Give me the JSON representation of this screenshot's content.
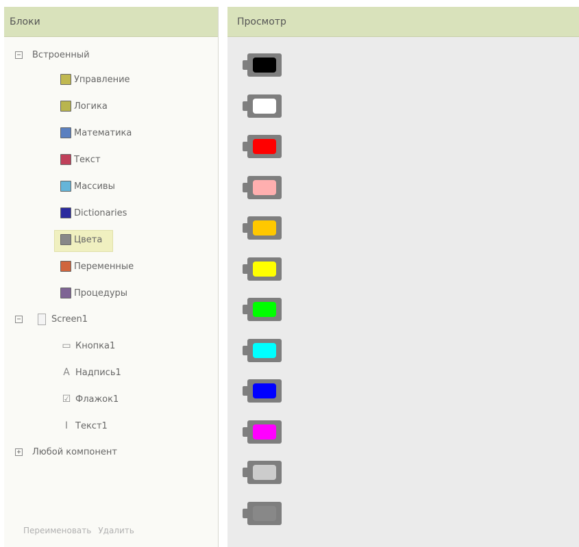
{
  "blocks_panel": {
    "header": "Блоки",
    "builtin": {
      "label": "Встроенный",
      "items": [
        {
          "label": "Управление",
          "color": "#c0b850",
          "icon": "control-swatch-icon"
        },
        {
          "label": "Логика",
          "color": "#b9b54e",
          "icon": "logic-swatch-icon"
        },
        {
          "label": "Математика",
          "color": "#5b80c0",
          "icon": "math-swatch-icon"
        },
        {
          "label": "Текст",
          "color": "#c0405a",
          "icon": "text-swatch-icon"
        },
        {
          "label": "Массивы",
          "color": "#65b5d9",
          "icon": "lists-swatch-icon"
        },
        {
          "label": "Dictionaries",
          "color": "#2a2a9e",
          "icon": "dictionaries-swatch-icon"
        },
        {
          "label": "Цвета",
          "color": "#888888",
          "icon": "colors-swatch-icon"
        },
        {
          "label": "Переменные",
          "color": "#d0653d",
          "icon": "variables-swatch-icon"
        },
        {
          "label": "Процедуры",
          "color": "#7e6494",
          "icon": "procedures-swatch-icon"
        }
      ]
    },
    "screen": {
      "label": "Screen1",
      "components": [
        {
          "label": "Кнопка1",
          "icon": "button-component-icon"
        },
        {
          "label": "Надпись1",
          "icon": "label-component-icon"
        },
        {
          "label": "Флажок1",
          "icon": "checkbox-component-icon"
        },
        {
          "label": "Текст1",
          "icon": "textbox-component-icon"
        }
      ]
    },
    "any_component": "Любой компонент",
    "footer": {
      "rename": "Переименовать",
      "delete": "Удалить"
    }
  },
  "viewer_panel": {
    "header": "Просмотр",
    "color_blocks": [
      {
        "name": "black",
        "color": "#000000"
      },
      {
        "name": "white",
        "color": "#ffffff"
      },
      {
        "name": "red",
        "color": "#ff0000"
      },
      {
        "name": "pink",
        "color": "#ffafaf"
      },
      {
        "name": "orange",
        "color": "#ffc800"
      },
      {
        "name": "yellow",
        "color": "#ffff00"
      },
      {
        "name": "green",
        "color": "#00ff00"
      },
      {
        "name": "cyan",
        "color": "#00ffff"
      },
      {
        "name": "blue",
        "color": "#0000ff"
      },
      {
        "name": "magenta",
        "color": "#ff00ff"
      },
      {
        "name": "light-gray",
        "color": "#cccccc"
      },
      {
        "name": "gray",
        "color": "#888888"
      }
    ]
  }
}
